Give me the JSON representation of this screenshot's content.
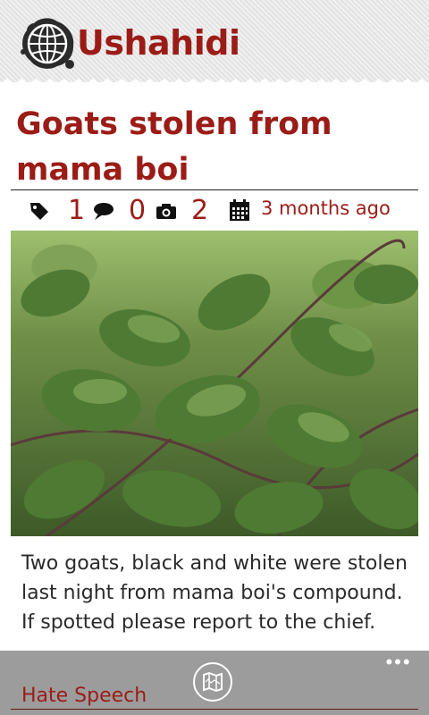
{
  "app": {
    "name": "Ushahidi",
    "brand_color": "#9b1c17"
  },
  "report": {
    "title": "Goats stolen from mama boi",
    "category_count": "1",
    "comment_count": "0",
    "photo_count": "2",
    "date": "3 months ago",
    "description": "Two goats, black and white were stolen last night from mama boi's compound. If spotted please report to the chief.",
    "category": "Hate Speech"
  },
  "icons": {
    "category": "tag-icon",
    "comments": "comment-bubble-icon",
    "photos": "camera-icon",
    "date": "calendar-icon",
    "map": "map-icon",
    "more": "more-dots-icon"
  },
  "appbar": {
    "more_label": "•••"
  }
}
